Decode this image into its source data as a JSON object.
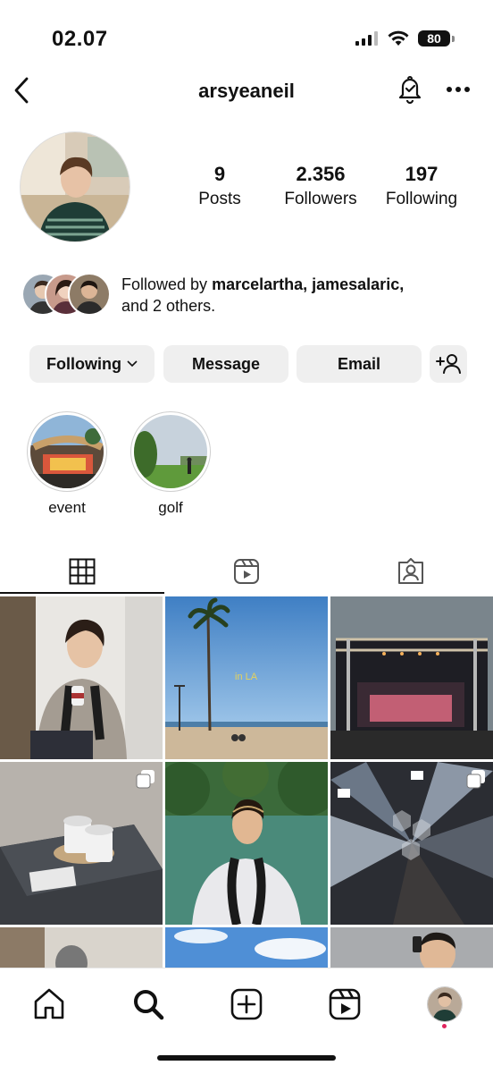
{
  "status": {
    "time": "02.07",
    "battery": "80"
  },
  "header": {
    "username": "arsyeaneil"
  },
  "profile": {
    "stats": [
      {
        "value": "9",
        "label": "Posts"
      },
      {
        "value": "2.356",
        "label": "Followers"
      },
      {
        "value": "197",
        "label": "Following"
      }
    ],
    "followed_by": {
      "prefix": "Followed by ",
      "names": "marcelartha, jamesalaric,",
      "rest": "and 2 others."
    }
  },
  "actions": {
    "following": "Following",
    "message": "Message",
    "email": "Email"
  },
  "highlights": [
    {
      "label": "event"
    },
    {
      "label": "golf"
    }
  ],
  "grid": {
    "overlay_text": "in LA"
  },
  "icons": {
    "back": "chevron-left-icon",
    "bell": "bell-icon",
    "more": "more-icon",
    "grid": "grid-icon",
    "reels": "reels-icon",
    "tagged": "tagged-icon",
    "home": "home-icon",
    "search": "search-icon",
    "create": "create-icon",
    "profile": "profile-avatar"
  },
  "colors": {
    "accent": "#111111",
    "button_bg": "#efefef",
    "notification_dot": "#e0245e"
  }
}
